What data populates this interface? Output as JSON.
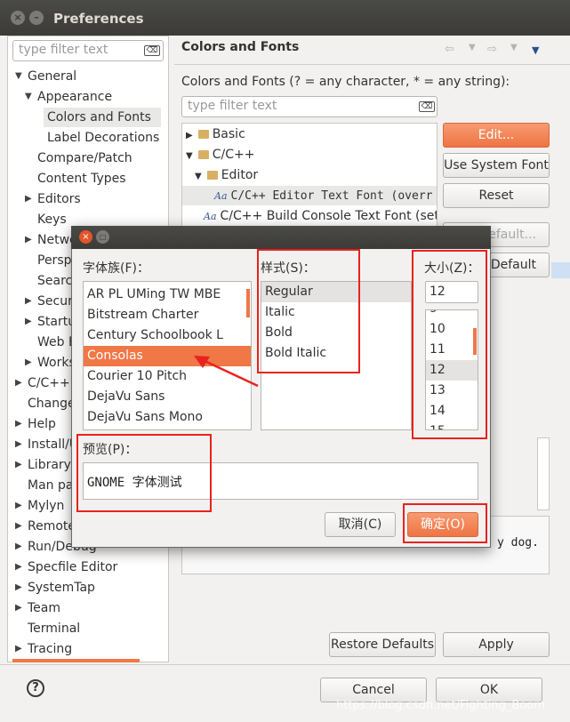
{
  "window": {
    "title": "Preferences",
    "close_symbol": "×",
    "min_symbol": "–"
  },
  "tree": {
    "filter_placeholder": "type filter text",
    "items": [
      {
        "label": "General",
        "twisty": "▼"
      },
      {
        "label": "Appearance",
        "twisty": "▼"
      },
      {
        "label": "Colors and Fonts",
        "twisty": ""
      },
      {
        "label": "Label Decorations",
        "twisty": ""
      },
      {
        "label": "Compare/Patch",
        "twisty": ""
      },
      {
        "label": "Content Types",
        "twisty": ""
      },
      {
        "label": "Editors",
        "twisty": "▶"
      },
      {
        "label": "Keys",
        "twisty": ""
      },
      {
        "label": "Netwo",
        "twisty": "▶"
      },
      {
        "label": "Persp",
        "twisty": ""
      },
      {
        "label": "Searc",
        "twisty": ""
      },
      {
        "label": "Secur",
        "twisty": "▶"
      },
      {
        "label": "Startu",
        "twisty": "▶"
      },
      {
        "label": "Web B",
        "twisty": ""
      },
      {
        "label": "Works",
        "twisty": "▶"
      },
      {
        "label": "C/C++",
        "twisty": "▶"
      },
      {
        "label": "Change",
        "twisty": ""
      },
      {
        "label": "Help",
        "twisty": "▶"
      },
      {
        "label": "Install/U",
        "twisty": "▶"
      },
      {
        "label": "Library",
        "twisty": "▶"
      },
      {
        "label": "Man pa",
        "twisty": ""
      },
      {
        "label": "Mylyn",
        "twisty": "▶"
      },
      {
        "label": "Remote",
        "twisty": "▶"
      },
      {
        "label": "Run/Debug",
        "twisty": "▶"
      },
      {
        "label": "Specfile Editor",
        "twisty": "▶"
      },
      {
        "label": "SystemTap",
        "twisty": "▶"
      },
      {
        "label": "Team",
        "twisty": "▶"
      },
      {
        "label": "Terminal",
        "twisty": ""
      },
      {
        "label": "Tracing",
        "twisty": "▶"
      }
    ]
  },
  "page": {
    "title": "Colors and Fonts",
    "description": "Colors and Fonts (? = any character, * = any string):",
    "filter_placeholder": "type filter text",
    "fonts_tree": [
      {
        "label": "Basic",
        "twisty": "▶"
      },
      {
        "label": "C/C++",
        "twisty": "▼"
      },
      {
        "label": "Editor",
        "twisty": "▼"
      },
      {
        "label": "C/C++ Editor Text Font (overr",
        "twisty": ""
      },
      {
        "label": "C/C++ Build Console Text Font (set to",
        "twisty": ""
      }
    ],
    "aa_glyph": "Aa",
    "buttons": {
      "edit": "Edit...",
      "use_system_font": "Use System Font",
      "reset": "Reset",
      "edit_default": "Default...",
      "go_default": "Default"
    },
    "preview_text": "y dog.",
    "restore_defaults": "Restore Defaults",
    "apply": "Apply"
  },
  "footer": {
    "help_symbol": "?",
    "cancel": "Cancel",
    "ok": "OK",
    "watermark": "https://blog.csdn.net/Fighting_Boom"
  },
  "font_dialog": {
    "close_symbol": "×",
    "max_symbol": "□",
    "family_label": "字体族(F)：",
    "style_label": "样式(S)：",
    "size_label": "大小(Z)：",
    "families": [
      "AR PL UMing TW MBE",
      "Bitstream Charter",
      "Century Schoolbook L",
      "Consolas",
      "Courier 10 Pitch",
      "DejaVu Sans",
      "DejaVu Sans Mono"
    ],
    "selected_family": "Consolas",
    "styles": [
      "Regular",
      "Italic",
      "Bold",
      "Bold Italic"
    ],
    "selected_style": "Regular",
    "size_value": "12",
    "sizes": [
      "9",
      "10",
      "11",
      "12",
      "13",
      "14",
      "15"
    ],
    "selected_size": "12",
    "preview_label": "预览(P)：",
    "preview_text": "GNOME 字体测试",
    "cancel": "取消(C)",
    "ok": "确定(O)"
  },
  "colors": {
    "accent": "#f07746",
    "annotation": "#e8231e"
  }
}
